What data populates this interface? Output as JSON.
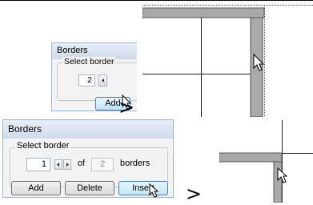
{
  "small_dialog": {
    "title": "Borders",
    "group_label": "Select border",
    "value": "2",
    "add_label": "Add"
  },
  "big_dialog": {
    "title": "Borders",
    "group_label": "Select border",
    "value": "1",
    "of_label": "of",
    "total": "2",
    "unit_label": "borders",
    "add_label": "Add",
    "delete_label": "Delete",
    "insert_label": "Insert"
  },
  "step_arrows": [
    ">",
    ">"
  ],
  "colors": {
    "border_fill": "#a9a9a9",
    "border_edge": "#555555",
    "button_hot": "#bee6fd",
    "button_hot_edge": "#3c7fb1"
  },
  "icons": [
    "pointer-cursor-icon",
    "hand-cursor-icon",
    "spin-left-icon",
    "spin-right-icon"
  ]
}
